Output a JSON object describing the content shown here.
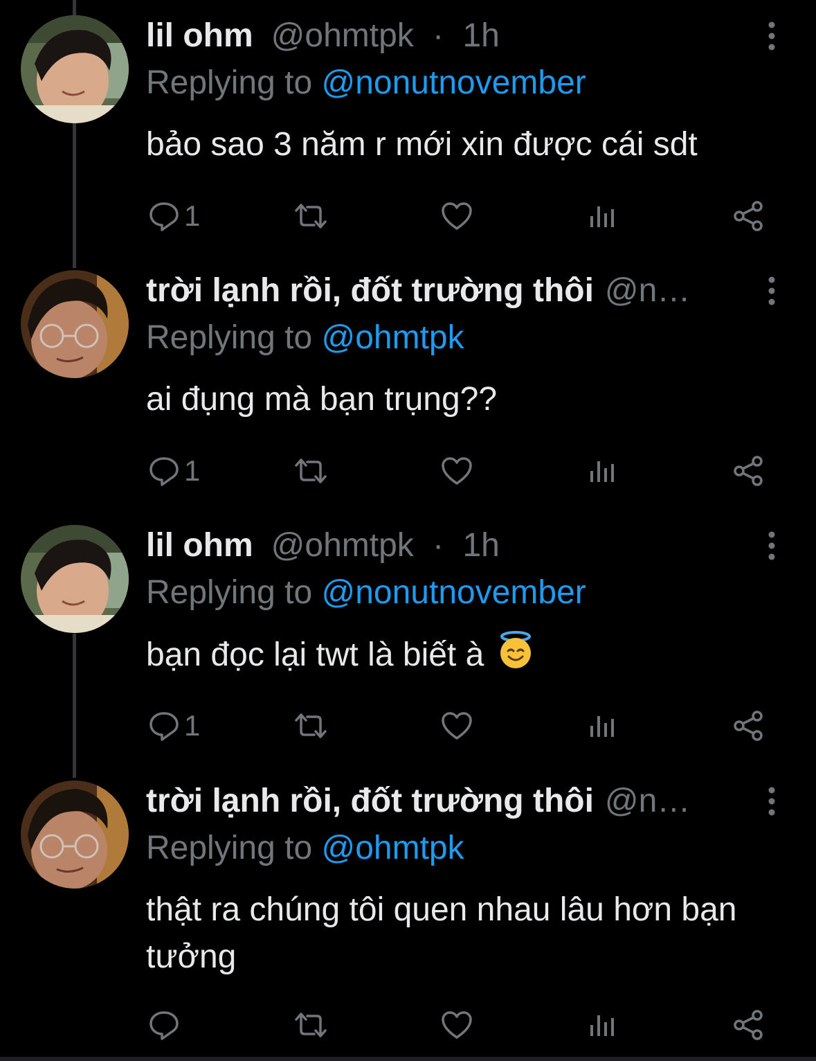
{
  "colors": {
    "background": "#000000",
    "text": "#e7e9ea",
    "muted": "#71767b",
    "accent": "#1d9bf0",
    "thread_line": "#333639"
  },
  "tweets": [
    {
      "display_name": "lil ohm",
      "handle": "@ohmtpk",
      "separator": "·",
      "time": "1h",
      "replying_prefix": "Replying to",
      "replying_to": "@nonutnovember",
      "text": "bảo sao 3 năm r mới xin được cái sdt",
      "reply_count": "1",
      "icons": [
        "avatar",
        "more-vert-icon",
        "reply-icon",
        "retweet-icon",
        "like-icon",
        "views-icon",
        "share-icon"
      ]
    },
    {
      "display_name": "trời lạnh rồi, đốt trường thôi",
      "handle": "@n…",
      "separator": "",
      "time": "",
      "replying_prefix": "Replying to",
      "replying_to": "@ohmtpk",
      "text": "ai đụng mà bạn trụng??",
      "reply_count": "1",
      "icons": [
        "avatar",
        "more-vert-icon",
        "reply-icon",
        "retweet-icon",
        "like-icon",
        "views-icon",
        "share-icon"
      ]
    },
    {
      "display_name": "lil ohm",
      "handle": "@ohmtpk",
      "separator": "·",
      "time": "1h",
      "replying_prefix": "Replying to",
      "replying_to": "@nonutnovember",
      "text": "bạn đọc lại twt là biết à",
      "emoji": "smiling-face-with-halo-emoji",
      "reply_count": "1",
      "icons": [
        "avatar",
        "more-vert-icon",
        "reply-icon",
        "retweet-icon",
        "like-icon",
        "views-icon",
        "share-icon"
      ]
    },
    {
      "display_name": "trời lạnh rồi, đốt trường thôi",
      "handle": "@n…",
      "separator": "",
      "time": "",
      "replying_prefix": "Replying to",
      "replying_to": "@ohmtpk",
      "text": "thật ra chúng tôi quen nhau lâu hơn bạn tưởng",
      "reply_count": "",
      "icons": [
        "avatar",
        "more-vert-icon",
        "reply-icon",
        "retweet-icon",
        "like-icon",
        "views-icon",
        "share-icon"
      ]
    }
  ]
}
